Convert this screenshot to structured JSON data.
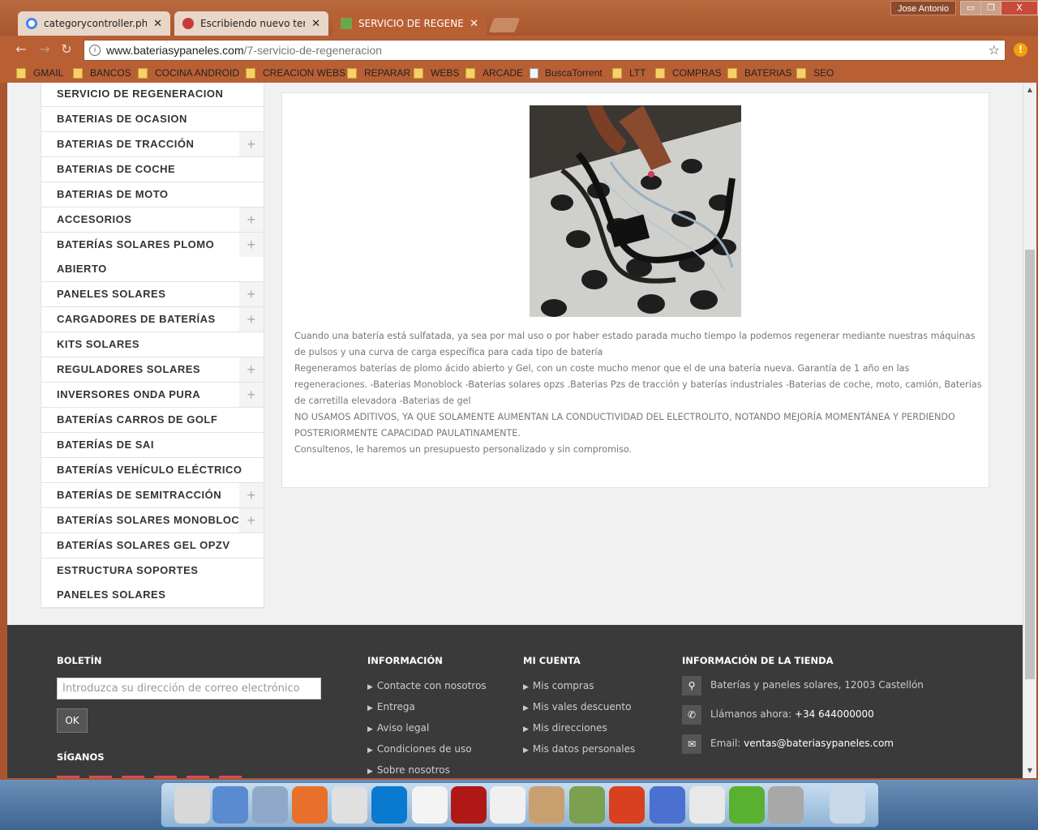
{
  "browser": {
    "user": "Jose Antonio",
    "tabs": [
      {
        "title": "categorycontroller.php p",
        "favicon_color": "#4285f4"
      },
      {
        "title": "Escribiendo nuevo tema",
        "favicon_color": "#c83a3a"
      },
      {
        "title": "SERVICIO DE REGENERAC",
        "favicon_color": "#6aa84f"
      }
    ],
    "url_domain": "www.bateriasypaneles.com",
    "url_path": "/7-servicio-de-regeneracion",
    "bookmarks": [
      {
        "label": "GMAIL",
        "type": "folder"
      },
      {
        "label": "BANCOS",
        "type": "folder"
      },
      {
        "label": "COCINA ANDROID",
        "type": "folder"
      },
      {
        "label": "CREACION WEBS",
        "type": "folder"
      },
      {
        "label": "REPARAR",
        "type": "folder"
      },
      {
        "label": "WEBS",
        "type": "folder"
      },
      {
        "label": "ARCADE",
        "type": "folder"
      },
      {
        "label": "BuscaTorrent",
        "type": "page"
      },
      {
        "label": "LTT",
        "type": "folder"
      },
      {
        "label": "COMPRAS",
        "type": "folder"
      },
      {
        "label": "BATERIAS",
        "type": "folder"
      },
      {
        "label": "SEO",
        "type": "folder"
      }
    ],
    "window_buttons": {
      "minimize": "▭",
      "maximize": "❐",
      "close": "X"
    }
  },
  "sidebar": {
    "categories": [
      {
        "label": "SERVICIO DE REGENERACION",
        "expandable": false
      },
      {
        "label": "BATERIAS DE OCASION",
        "expandable": false
      },
      {
        "label": "BATERIAS DE TRACCIÓN",
        "expandable": true
      },
      {
        "label": "BATERIAS DE COCHE",
        "expandable": false
      },
      {
        "label": "BATERIAS DE MOTO",
        "expandable": false
      },
      {
        "label": "ACCESORIOS",
        "expandable": true
      },
      {
        "label": "BATERÍAS SOLARES PLOMO ABIERTO",
        "expandable": true
      },
      {
        "label": "PANELES SOLARES",
        "expandable": true
      },
      {
        "label": "CARGADORES DE BATERÍAS",
        "expandable": true
      },
      {
        "label": "KITS SOLARES",
        "expandable": false
      },
      {
        "label": "REGULADORES SOLARES",
        "expandable": true
      },
      {
        "label": "INVERSORES ONDA PURA",
        "expandable": true
      },
      {
        "label": "BATERÍAS CARROS DE GOLF",
        "expandable": false
      },
      {
        "label": "BATERÍAS DE SAI",
        "expandable": false
      },
      {
        "label": "BATERÍAS VEHÍCULO ELÉCTRICO",
        "expandable": false
      },
      {
        "label": "BATERÍAS DE SEMITRACCIÓN",
        "expandable": true
      },
      {
        "label": "BATERÍAS SOLARES MONOBLOCK",
        "expandable": true
      },
      {
        "label": "BATERÍAS SOLARES GEL OPZV",
        "expandable": false
      },
      {
        "label": "ESTRUCTURA SOPORTES PANELES SOLARES",
        "expandable": false
      }
    ],
    "plus_glyph": "+"
  },
  "content": {
    "paragraphs": [
      "Cuando una batería está sulfatada, ya sea por mal uso o por haber estado parada mucho tiempo la podemos regenerar mediante nuestras máquinas de pulsos y una curva de carga específica para cada tipo de batería",
      "Regeneramos baterías de plomo ácido abierto y Gel, con un coste mucho menor que el de una batería nueva. Garantía de 1 año en las regeneraciones. -Baterias Monoblock -Baterias solares opzs .Baterias Pzs de tracción y baterías industriales -Baterias de coche, moto, camión, Baterias de carretilla elevadora -Baterias de gel",
      "NO USAMOS ADITIVOS, YA QUE SOLAMENTE AUMENTAN LA CONDUCTIVIDAD DEL ELECTROLITO, NOTANDO MEJORÍA MOMENTÁNEA Y PERDIENDO POSTERIORMENTE CAPACIDAD PAULATINAMENTE.",
      "Consultenos, le haremos un presupuesto personalizado y sin compromiso."
    ]
  },
  "footer": {
    "newsletter_title": "BOLETÍN",
    "newsletter_placeholder": "Introduzca su dirección de correo electrónico",
    "newsletter_button": "OK",
    "follow_title": "SÍGANOS",
    "info_title": "INFORMACIÓN",
    "info_links": [
      "Contacte con nosotros",
      "Entrega",
      "Aviso legal",
      "Condiciones de uso",
      "Sobre nosotros"
    ],
    "account_title": "MI CUENTA",
    "account_links": [
      "Mis compras",
      "Mis vales descuento",
      "Mis direcciones",
      "Mis datos personales"
    ],
    "store_title": "INFORMACIÓN DE LA TIENDA",
    "store_address": "Baterías y paneles solares, 12003 Castellón",
    "store_phone_label": "Llámanos ahora:",
    "store_phone": "+34 644000000",
    "store_email_label": "Email:",
    "store_email": "ventas@bateriasypaneles.com",
    "icons": {
      "address": "location-icon",
      "phone": "phone-icon",
      "email": "envelope-icon"
    }
  },
  "taskbar": {
    "apps": [
      "monitor-app-icon",
      "network-globe-icon",
      "documents-icon",
      "firefox-icon",
      "chrome-icon",
      "dropbox-icon",
      "blank-document-icon",
      "filezilla-icon",
      "pinwheel-icon",
      "colosseum-icon",
      "notepad-icon",
      "ccleaner-icon",
      "star-icon",
      "cow-icon",
      "plus-app-icon",
      "tools-icon",
      "recycle-bin-icon"
    ]
  }
}
